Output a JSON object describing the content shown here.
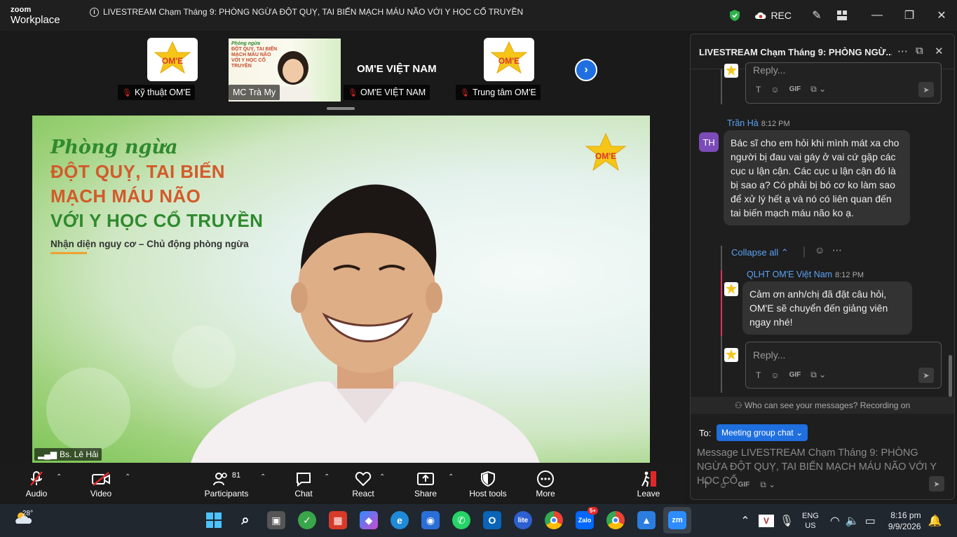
{
  "app": {
    "brand_top": "zoom",
    "brand_bottom": "Workplace",
    "window_title": "LIVESTREAM Chạm Tháng 9: PHÒNG NGỪA ĐỘT QUỴ, TAI BIẾN MẠCH MÁU NÃO VỚI Y HỌC CỔ TRUYỀN",
    "rec_label": "REC"
  },
  "thumbnails": [
    {
      "name": "Kỹ thuật OM'E",
      "muted": true
    },
    {
      "name": "MC Trà My",
      "muted": false
    },
    {
      "name": "OM'E VIỆT NAM",
      "muted": true,
      "display_text": "OM'E VIỆT NAM"
    },
    {
      "name": "Trung tâm OM'E",
      "muted": true
    }
  ],
  "logo_text": "OM'E",
  "slide": {
    "script": "Phòng ngừa",
    "line1": "ĐỘT QUỴ, TAI BIẾN",
    "line2": "MẠCH MÁU NÃO",
    "line3": "VỚI Y HỌC CỔ TRUYỀN",
    "subtitle": "Nhận diện nguy cơ – Chủ động phòng ngừa"
  },
  "active_speaker": "Bs. Lê Hải",
  "toolbar": {
    "audio": "Audio",
    "video": "Video",
    "participants": "Participants",
    "participants_count": "81",
    "chat": "Chat",
    "react": "React",
    "share": "Share",
    "host_tools": "Host tools",
    "more": "More",
    "leave": "Leave"
  },
  "chat": {
    "title": "LIVESTREAM Chạm Tháng 9: PHÒNG NGỪ...",
    "reply_placeholder": "Reply...",
    "gif_label": "GIF",
    "msg1": {
      "sender": "Trần Hà",
      "time": "8:12 PM",
      "initials": "TH",
      "text": "Bác sĩ cho em hỏi khi mình mát xa cho người bị đau vai gáy ở vai cứ gặp các cục u lận cận. Các cục u lận cận đó là bị sao ạ? Có phải bị bó cơ ko làm sao để xử lý hết ạ và nó có liên quan đến tai biến mạch máu não ko ạ."
    },
    "collapse_label": "Collapse all",
    "msg2": {
      "sender": "QLHT OM'E Việt Nam",
      "time": "8:12 PM",
      "text": "Cảm ơn anh/chị đã đặt câu hỏi, OM'E sẽ chuyển đến giảng viên ngay nhé!"
    },
    "visibility_note": "Who can see your messages? Recording on",
    "to_label": "To:",
    "recipient": "Meeting group chat",
    "input_placeholder": "Message LIVESTREAM Chạm Tháng 9: PHÒNG NGỪA ĐỘT QUỴ, TAI BIẾN MẠCH MÁU NÃO VỚI Y HỌC CỔ"
  },
  "taskbar": {
    "weather": "28°",
    "lang1": "ENG",
    "lang2": "US",
    "time": "8:16 pm",
    "date": "9/9/2026",
    "zalo_badge": "5+"
  }
}
